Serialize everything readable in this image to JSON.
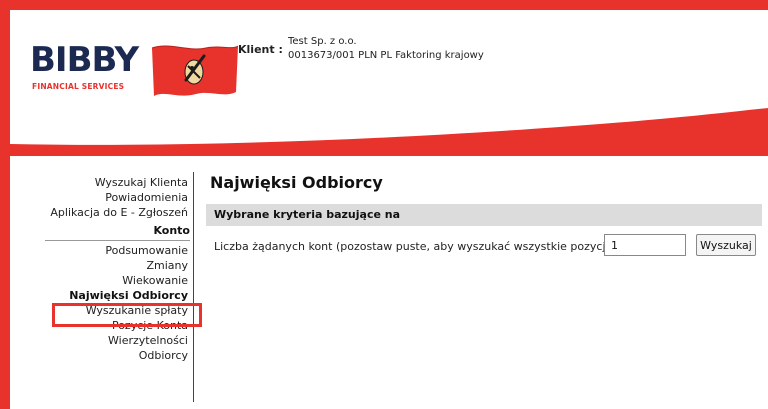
{
  "logo": {
    "word": "BIBBY",
    "subtitle": "FINANCIAL SERVICES",
    "flag_icon": "red-flag-with-emblem-icon"
  },
  "client": {
    "label": "Klient :",
    "name": "Test Sp. z o.o.",
    "account": "0013673/001 PLN PL Faktoring krajowy"
  },
  "sidebar": {
    "items_top": [
      {
        "label": "Wyszukaj Klienta"
      },
      {
        "label": "Powiadomienia"
      },
      {
        "label": "Aplikacja do E - Zgłoszeń"
      }
    ],
    "section_label": "Konto",
    "items_konto": [
      {
        "label": "Podsumowanie"
      },
      {
        "label": "Zmiany"
      },
      {
        "label": "Wiekowanie"
      },
      {
        "label": "Najwięksi Odbiorcy",
        "active": true
      },
      {
        "label": "Wyszukanie spłaty"
      },
      {
        "label": "Pozycje Konta Wierzytelności"
      },
      {
        "label": "Odbiorcy"
      }
    ]
  },
  "main": {
    "title": "Najwięksi Odbiorcy",
    "criteria_heading": "Wybrane kryteria bazujące na",
    "row_label": "Liczba żądanych kont (pozostaw puste, aby wyszukać wszystkie pozycje)",
    "row_value": "1",
    "search_button": "Wyszukaj"
  },
  "colors": {
    "brand_red": "#e8322c",
    "brand_navy": "#1c2a52",
    "criteria_bg": "#dcdcdc"
  }
}
